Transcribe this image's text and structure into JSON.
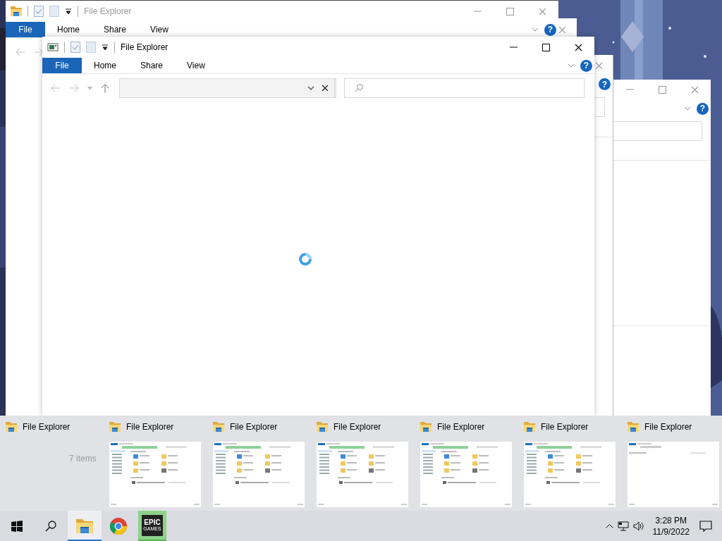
{
  "windows": [
    {
      "kind": "side",
      "help": "?"
    },
    {
      "kind": "edge",
      "help": "?"
    },
    {
      "kind": "edge"
    },
    {
      "kind": "full",
      "title": "File Explorer",
      "active": false,
      "help": "?",
      "tabs": [
        {
          "label": "File",
          "kind": "file"
        },
        {
          "label": "Home",
          "kind": "tab"
        },
        {
          "label": "Share",
          "kind": "tab"
        },
        {
          "label": "View",
          "kind": "tab"
        }
      ]
    },
    {
      "kind": "full",
      "title": "File Explorer",
      "active": true,
      "help": "?",
      "loading": true,
      "tabs": [
        {
          "label": "File",
          "kind": "file"
        },
        {
          "label": "Home",
          "kind": "tab"
        },
        {
          "label": "Share",
          "kind": "tab"
        },
        {
          "label": "View",
          "kind": "tab"
        }
      ]
    }
  ],
  "preview_flyout": {
    "items": [
      {
        "title": "File Explorer",
        "kind": "none",
        "status": "7 items"
      },
      {
        "title": "File Explorer",
        "kind": "folders"
      },
      {
        "title": "File Explorer",
        "kind": "folders"
      },
      {
        "title": "File Explorer",
        "kind": "folders"
      },
      {
        "title": "File Explorer",
        "kind": "folders"
      },
      {
        "title": "File Explorer",
        "kind": "folders"
      },
      {
        "title": "File Explorer",
        "kind": "blank"
      }
    ]
  },
  "taskbar": {
    "apps": [
      {
        "kind": "explorer",
        "selected": true,
        "highlighted": false
      },
      {
        "kind": "chrome",
        "selected": false,
        "highlighted": false
      },
      {
        "kind": "epic",
        "selected": false,
        "highlighted": true,
        "label": "EPIC",
        "sublabel": "GAMES"
      }
    ],
    "clock": {
      "time": "3:28 PM",
      "date": "11/9/2022"
    }
  }
}
